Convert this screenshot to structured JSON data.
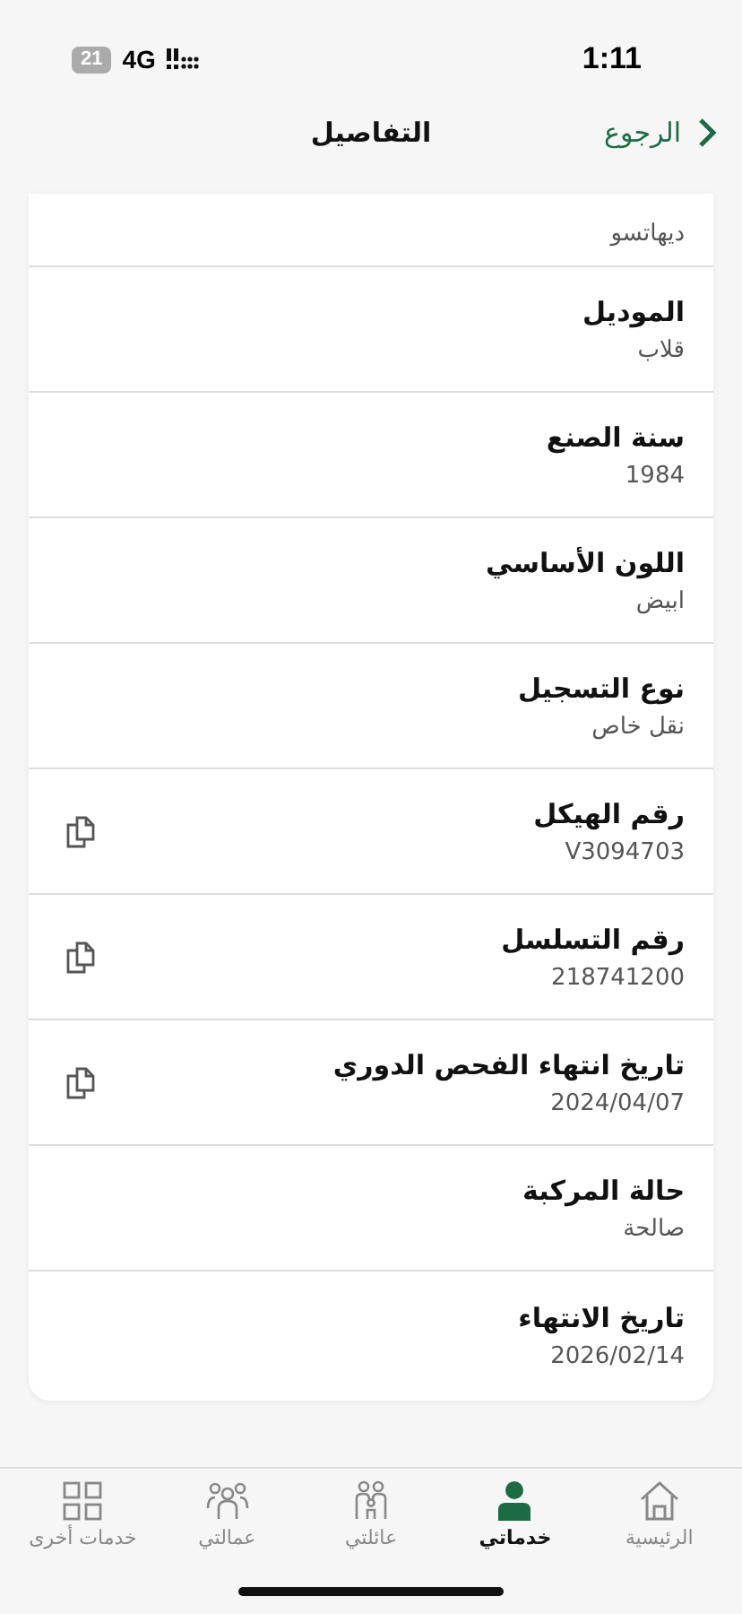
{
  "status_bar": {
    "time": "1:11",
    "network": "4G",
    "battery": "21"
  },
  "header": {
    "back": "الرجوع",
    "title": "التفاصيل"
  },
  "fields": [
    {
      "value": "ديهاتسو",
      "copyable": false
    },
    {
      "label": "الموديل",
      "value": "قلاب",
      "copyable": false
    },
    {
      "label": "سنة الصنع",
      "value": "1984",
      "copyable": false
    },
    {
      "label": "اللون الأساسي",
      "value": "ابيض",
      "copyable": false
    },
    {
      "label": "نوع التسجيل",
      "value": "نقل خاص",
      "copyable": false
    },
    {
      "label": "رقم الهيكل",
      "value": "V3094703",
      "copyable": true
    },
    {
      "label": "رقم التسلسل",
      "value": "218741200",
      "copyable": true
    },
    {
      "label": "تاريخ انتهاء الفحص الدوري",
      "value": "2024/04/07",
      "copyable": true
    },
    {
      "label": "حالة المركبة",
      "value": "صالحة",
      "copyable": false
    },
    {
      "label": "تاريخ الانتهاء",
      "value": "2026/02/14",
      "copyable": false
    }
  ],
  "tabs": [
    {
      "label": "الرئيسية",
      "kind": "home",
      "selected": false
    },
    {
      "label": "خدماتي",
      "kind": "person",
      "selected": true
    },
    {
      "label": "عائلتي",
      "kind": "family",
      "selected": false
    },
    {
      "label": "عمالتي",
      "kind": "workers",
      "selected": false
    },
    {
      "label": "خدمات أخرى",
      "kind": "grid",
      "selected": false
    }
  ]
}
